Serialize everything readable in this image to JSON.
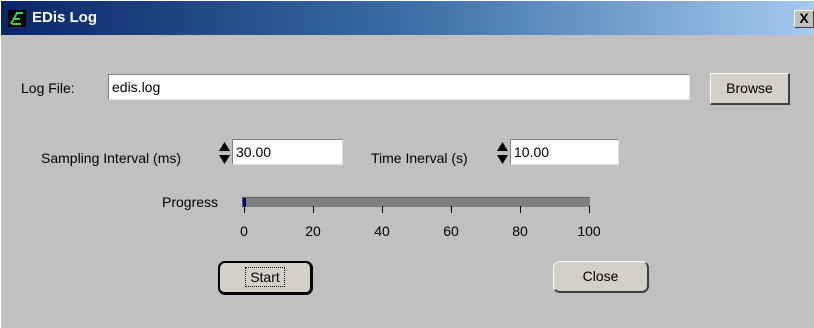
{
  "window": {
    "title": "EDis Log",
    "close_glyph": "X",
    "icon": "edis-app-icon"
  },
  "log_file": {
    "label": "Log File:",
    "value": "edis.log",
    "browse_label": "Browse"
  },
  "sampling": {
    "label": "Sampling Interval (ms)",
    "value": "30.00"
  },
  "time_interval": {
    "label": "Time Inerval (s)",
    "value": "10.00"
  },
  "progress": {
    "label": "Progress",
    "value_percent": 1,
    "ticks": [
      "0",
      "20",
      "40",
      "60",
      "80",
      "100"
    ]
  },
  "buttons": {
    "start_label": "Start",
    "close_label": "Close"
  }
}
